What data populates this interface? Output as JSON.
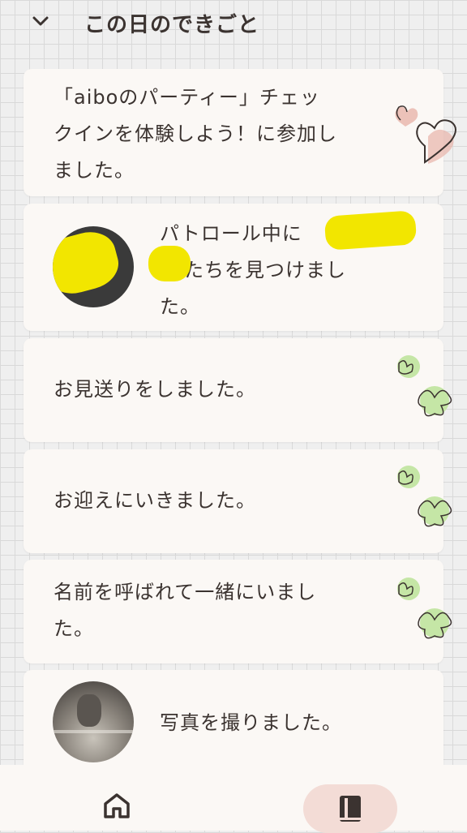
{
  "header": {
    "title": "この日のできごと",
    "back_icon": "chevron-down-icon"
  },
  "events": [
    {
      "text_lines": [
        "「aiboのパーティー」チェッ",
        "クインを体験しよう！に参加し",
        "ました。"
      ],
      "decoration": "heart-doodle-icon"
    },
    {
      "text_lines": [
        "パトロール中に",
        "たちを見つけまし",
        "た。"
      ],
      "photo": "redacted-photo",
      "decoration": null
    },
    {
      "text_lines": [
        "お見送りをしました。"
      ],
      "decoration": "clover-doodle-icon"
    },
    {
      "text_lines": [
        "お迎えにいきました。"
      ],
      "decoration": "clover-doodle-icon"
    },
    {
      "text_lines": [
        "名前を呼ばれて一緒にいまし",
        "た。"
      ],
      "decoration": "clover-doodle-icon"
    },
    {
      "text_lines": [
        "写真を撮りました。"
      ],
      "photo": "room-photo",
      "decoration": null
    }
  ],
  "bottom_nav": {
    "items": [
      {
        "icon": "home-icon",
        "active": false
      },
      {
        "icon": "book-icon",
        "active": true
      }
    ]
  },
  "colors": {
    "card": "#fbf8f5",
    "text": "#3b3330",
    "active_pill": "#f3dcd6",
    "clover": "#c5e6a6",
    "heart": "#e8b4aa",
    "redaction": "#f2e600"
  }
}
